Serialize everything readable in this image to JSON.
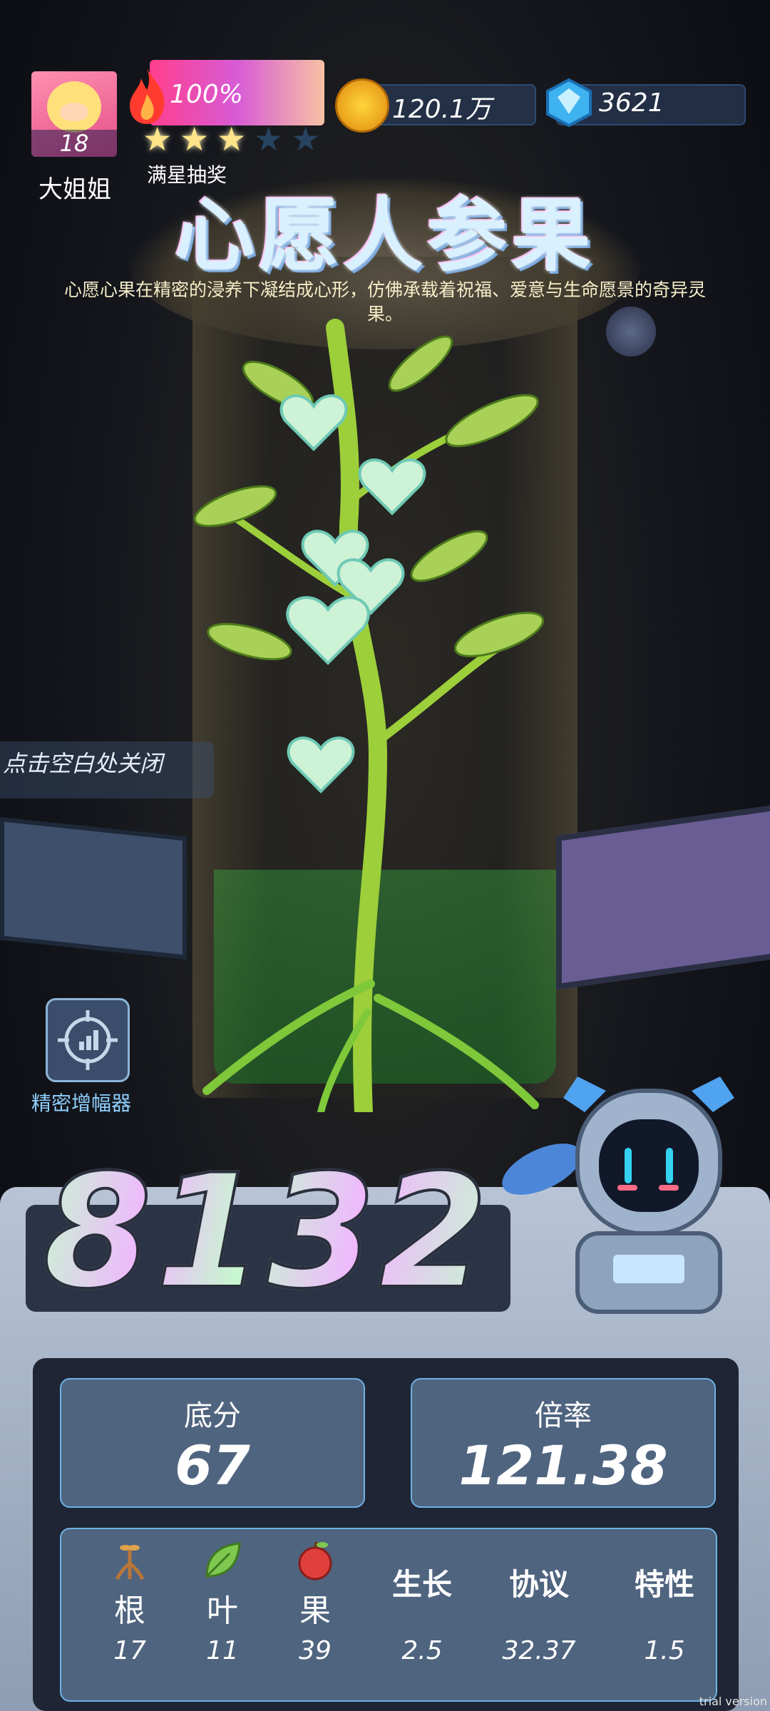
{
  "player": {
    "name": "大姐姐",
    "level": "18"
  },
  "energy": {
    "percent": "100%",
    "stars_filled": 3,
    "stars_total": 5,
    "label": "满星抽奖"
  },
  "resources": {
    "gold": "120.1万",
    "gems": "3621"
  },
  "item": {
    "title": "心愿人参果",
    "description": "心愿心果在精密的浸养下凝结成心形，仿佛承载着祝福、爱意与生命愿景的奇异灵果。"
  },
  "hints": {
    "close": "点击空白处关闭",
    "amplifier": "精密增幅器"
  },
  "score": {
    "total": "8132",
    "base_label": "底分",
    "base_value": "67",
    "multiplier_label": "倍率",
    "multiplier_value": "121.38"
  },
  "attributes": [
    {
      "label": "根",
      "value": "17",
      "icon": "root-icon"
    },
    {
      "label": "叶",
      "value": "11",
      "icon": "leaf-icon"
    },
    {
      "label": "果",
      "value": "39",
      "icon": "apple-icon"
    },
    {
      "label": "生长",
      "value": "2.5"
    },
    {
      "label": "协议",
      "value": "32.37"
    },
    {
      "label": "特性",
      "value": "1.5"
    }
  ],
  "watermark": "trial version",
  "colors": {
    "accent_blue": "#6fb1e6",
    "panel": "#4f647f",
    "gold": "#ffd53a",
    "pink": "#ff3f8d"
  }
}
